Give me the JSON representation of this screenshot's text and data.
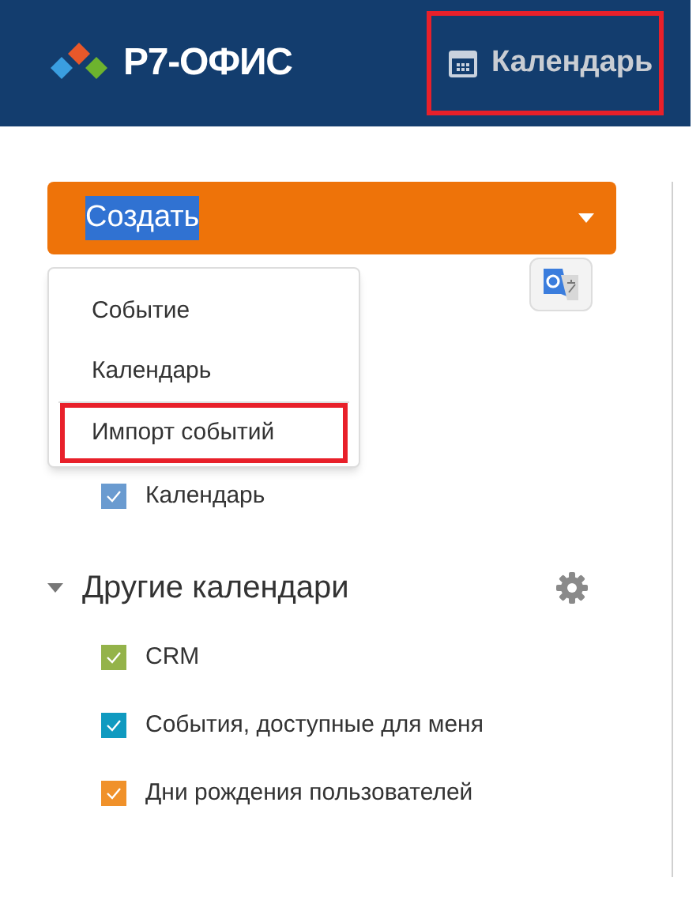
{
  "header": {
    "logo_text": "Р7-ОФИС",
    "module": {
      "label": "Календарь",
      "highlighted": true
    }
  },
  "create_button": {
    "label": "Создать",
    "text_selected": true
  },
  "create_menu": [
    {
      "label": "Событие",
      "highlighted": false
    },
    {
      "label": "Календарь",
      "highlighted": false
    },
    {
      "label": "Импорт событий",
      "highlighted": true
    }
  ],
  "my_calendars": [
    {
      "label": "Календарь",
      "checked": true,
      "color": "#6a9bd0"
    }
  ],
  "other_calendars": {
    "title": "Другие календари",
    "expanded": true,
    "items": [
      {
        "label": "CRM",
        "checked": true,
        "color": "#94b34a"
      },
      {
        "label": "События, доступные для меня",
        "checked": true,
        "color": "#0f9ac0"
      },
      {
        "label": "Дни рождения пользователей",
        "checked": true,
        "color": "#f0912a"
      }
    ]
  }
}
